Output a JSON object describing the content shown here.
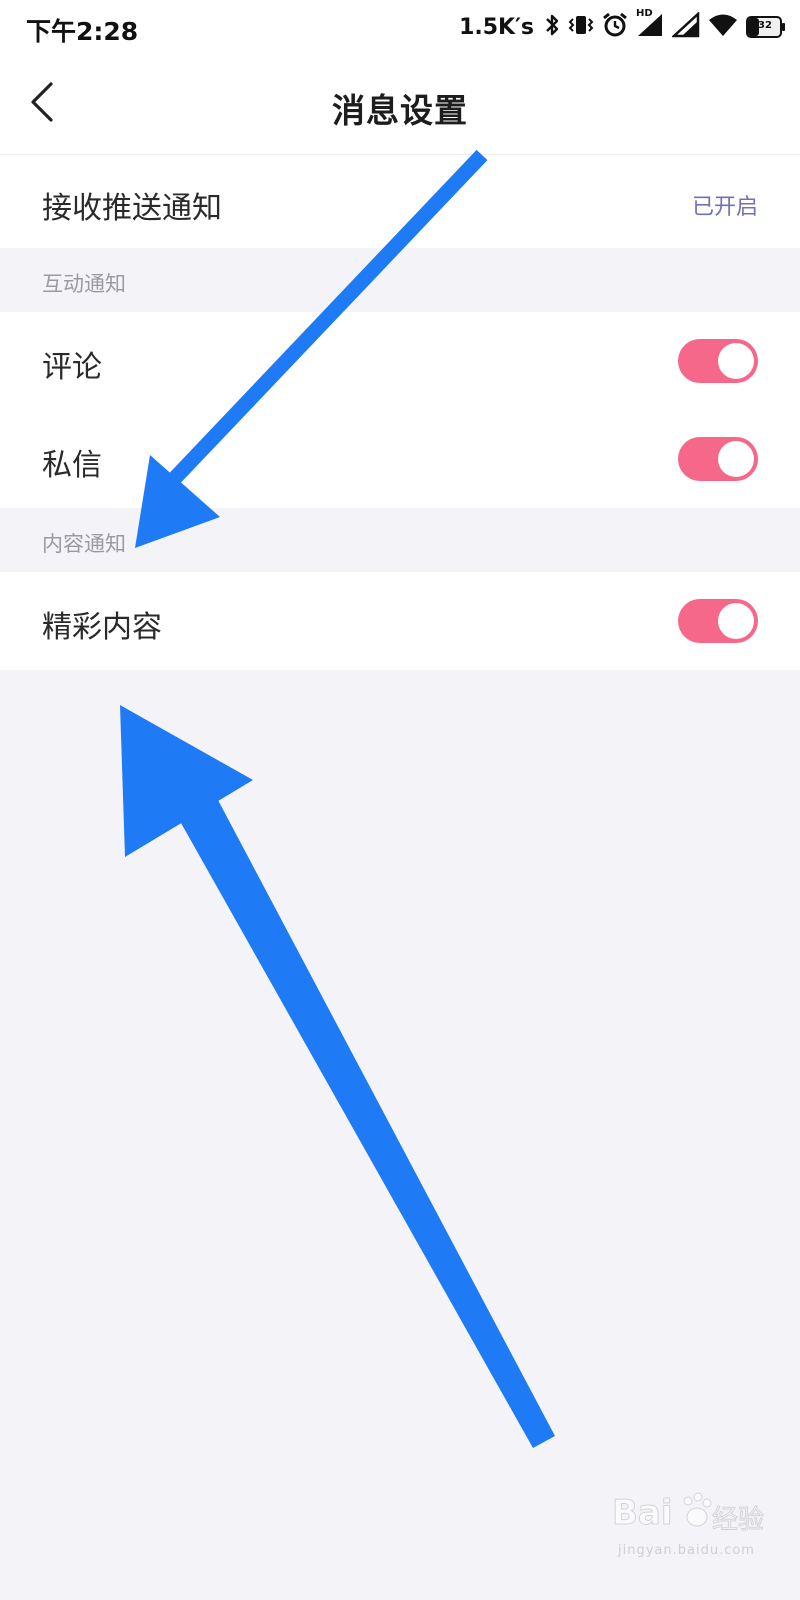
{
  "status_bar": {
    "time": "下午2:28",
    "net_speed": "1.5K′s",
    "hd_label": "HD",
    "battery_level": "32",
    "icons": [
      "bluetooth-icon",
      "vibrate-icon",
      "alarm-icon",
      "signal-icon",
      "signal-icon",
      "wifi-icon",
      "battery-icon"
    ]
  },
  "header": {
    "title": "消息设置",
    "back_icon": "chevron-left-icon"
  },
  "push": {
    "label": "接收推送通知",
    "status": "已开启"
  },
  "sections": [
    {
      "title": "互动通知",
      "items": [
        {
          "label": "评论",
          "enabled": true
        },
        {
          "label": "私信",
          "enabled": true
        }
      ]
    },
    {
      "title": "内容通知",
      "items": [
        {
          "label": "精彩内容",
          "enabled": true
        }
      ]
    }
  ],
  "colors": {
    "accent": "#7070b8",
    "toggle_on": "#f56889",
    "arrow": "#1f7af5",
    "background": "#f4f4f8"
  },
  "watermark": {
    "brand": "Bai",
    "brand_suffix": "经验",
    "url": "jingyan.baidu.com"
  }
}
